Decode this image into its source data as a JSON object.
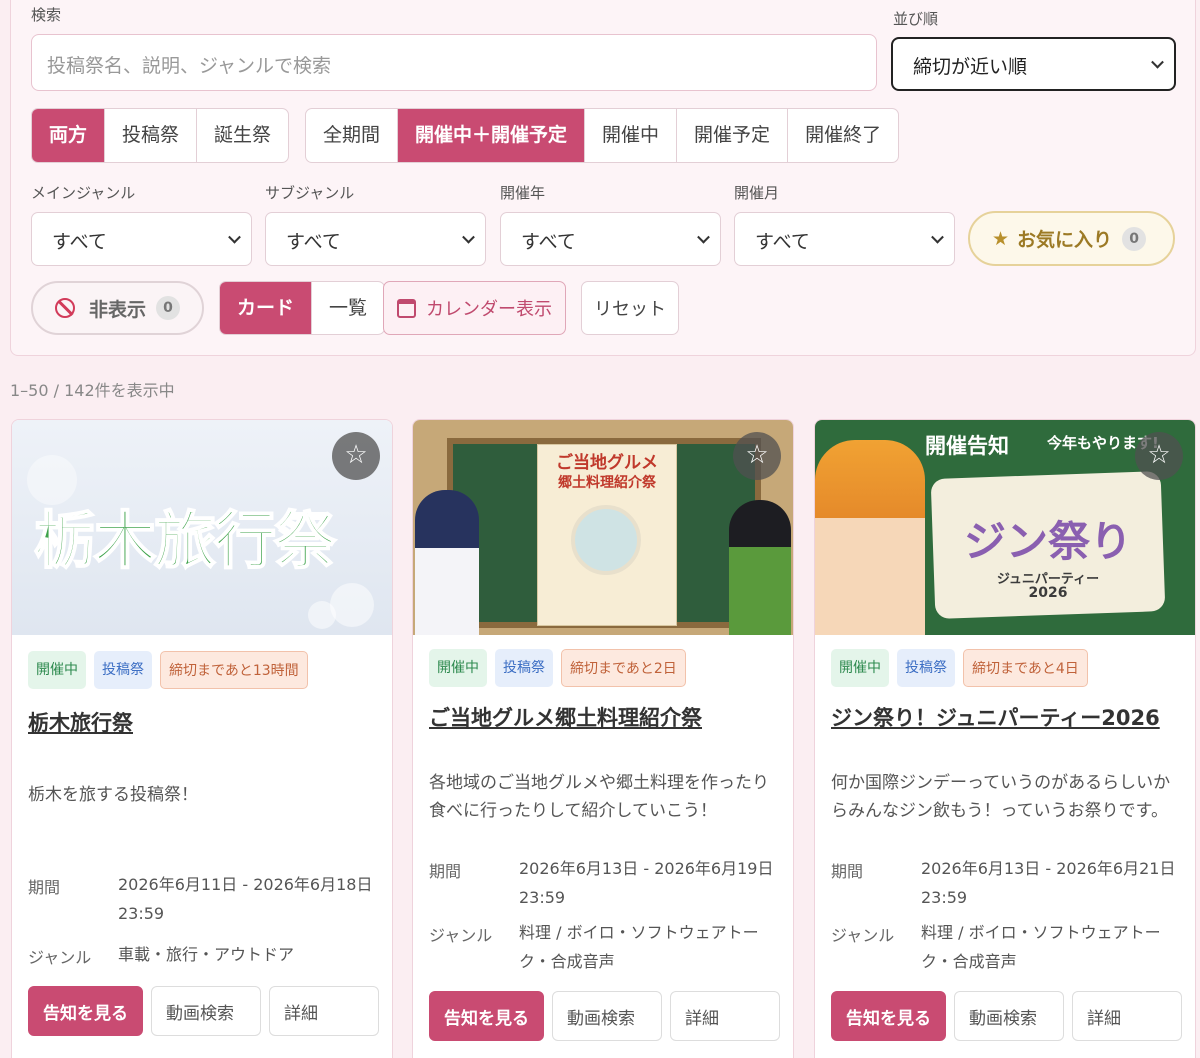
{
  "search": {
    "label": "検索",
    "placeholder": "投稿祭名、説明、ジャンルで検索"
  },
  "sort": {
    "label": "並び順",
    "value": "締切が近い順"
  },
  "type_filter": [
    "両方",
    "投稿祭",
    "誕生祭"
  ],
  "period_filter": [
    "全期間",
    "開催中＋開催予定",
    "開催中",
    "開催予定",
    "開催終了"
  ],
  "filters": {
    "main_genre": {
      "label": "メインジャンル",
      "value": "すべて"
    },
    "sub_genre": {
      "label": "サブジャンル",
      "value": "すべて"
    },
    "year": {
      "label": "開催年",
      "value": "すべて"
    },
    "month": {
      "label": "開催月",
      "value": "すべて"
    }
  },
  "favorites": {
    "label": "お気に入り",
    "count": "0"
  },
  "hidden": {
    "label": "非表示",
    "count": "0"
  },
  "view_toggle": [
    "カード",
    "一覧"
  ],
  "calendar_label": "カレンダー表示",
  "reset_label": "リセット",
  "result_text": "1–50 / 142件を表示中",
  "cards": [
    {
      "banner": "栃木旅行祭",
      "tags": [
        "開催中",
        "投稿祭",
        "締切まであと13時間"
      ],
      "title": "栃木旅行祭",
      "desc": "栃木を旅する投稿祭！",
      "period_label": "期間",
      "period": "2026年6月11日 - 2026年6月18日 23:59",
      "genre_label": "ジャンル",
      "genre": "車載・旅行・アウトドア",
      "buttons": [
        "告知を見る",
        "動画検索",
        "詳細"
      ]
    },
    {
      "banner_line1": "ご当地グルメ",
      "banner_line2": "郷土料理紹介祭",
      "tags": [
        "開催中",
        "投稿祭",
        "締切まであと2日"
      ],
      "title": "ご当地グルメ郷土料理紹介祭",
      "desc": "各地域のご当地グルメや郷土料理を作ったり食べに行ったりして紹介していこう！",
      "period_label": "期間",
      "period": "2026年6月13日 - 2026年6月19日 23:59",
      "genre_label": "ジャンル",
      "genre": "料理 / ボイロ・ソフトウェアトーク・合成音声",
      "buttons": [
        "告知を見る",
        "動画検索",
        "詳細"
      ]
    },
    {
      "banner_top_left": "開催告知",
      "banner_top_right": "今年もやります!",
      "banner_title": "ジン祭り",
      "banner_sub1": "ジュニパーティー",
      "banner_sub2": "2026",
      "tags": [
        "開催中",
        "投稿祭",
        "締切まであと4日"
      ],
      "title": "ジン祭り！ジュニパーティー2026",
      "desc": "何か国際ジンデーっていうのがあるらしいからみんなジン飲もう！っていうお祭りです。",
      "period_label": "期間",
      "period": "2026年6月13日 - 2026年6月21日 23:59",
      "genre_label": "ジャンル",
      "genre": "料理 / ボイロ・ソフトウェアトーク・合成音声",
      "buttons": [
        "告知を見る",
        "動画検索",
        "詳細"
      ]
    }
  ],
  "colors": {
    "accent": "#c94b72",
    "background": "#fbeef2",
    "favorite_gold": "#b8902c"
  },
  "icons": [
    "star-icon",
    "prohibit-icon",
    "calendar-icon",
    "chevron-down-icon"
  ]
}
